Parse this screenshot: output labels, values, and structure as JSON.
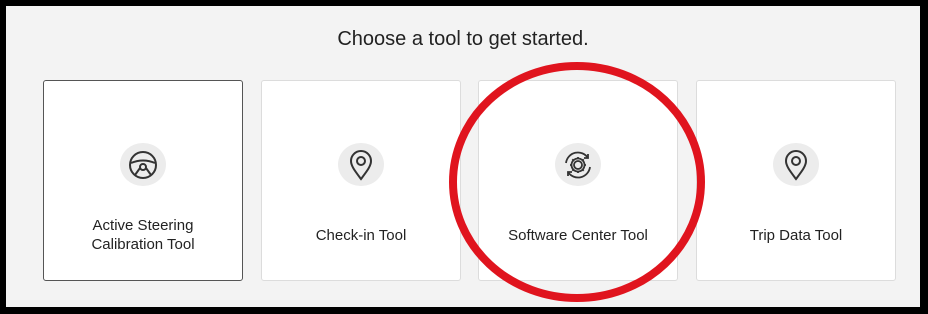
{
  "heading": "Choose a tool to get started.",
  "tools": [
    {
      "label_line1": "Active Steering",
      "label_line2": "Calibration Tool",
      "icon": "steering-wheel-icon",
      "selected": true
    },
    {
      "label": "Check-in Tool",
      "icon": "map-pin-icon"
    },
    {
      "label": "Software Center Tool",
      "icon": "gear-sync-icon"
    },
    {
      "label": "Trip Data Tool",
      "icon": "map-pin-icon"
    }
  ],
  "colors": {
    "background": "#f3f3f3",
    "card": "#ffffff",
    "icon_circle": "#ececec",
    "annotation_red": "#e0141e"
  }
}
